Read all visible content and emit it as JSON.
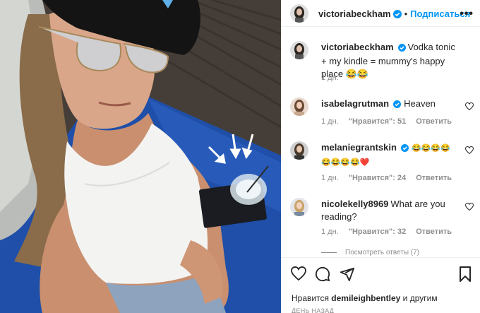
{
  "post": {
    "author": "victoriabeckham",
    "follow_label": "Подписаться",
    "dot": "•",
    "more_label": "•••"
  },
  "caption": {
    "username": "victoriabeckham",
    "text": "Vodka tonic + my kindle = mummy's happy place 😂😂",
    "time": "1 дн."
  },
  "comments": [
    {
      "username": "isabelagrutman",
      "verified": true,
      "text": "Heaven",
      "time": "1 дн.",
      "likes": "\"Нравится\": 51",
      "reply": "Ответить"
    },
    {
      "username": "melaniegrantskin",
      "verified": true,
      "text": "😂😂😂😂😂😂😂😂❤️",
      "time": "1 дн.",
      "likes": "\"Нравится\": 24",
      "reply": "Ответить"
    },
    {
      "username": "nicolekelly8969",
      "verified": false,
      "text": "What are you reading?",
      "time": "1 дн.",
      "likes": "\"Нравится\": 32",
      "reply": "Ответить",
      "view_replies": "Посмотреть ответы (7)"
    }
  ],
  "footer": {
    "liked_prefix": "Нравится",
    "liked_user": "demileighbentley",
    "liked_suffix": "и другим",
    "timestamp": "ДЕНЬ НАЗАД"
  },
  "icons": {
    "verified": "verified-badge-icon",
    "heart": "heart-icon",
    "comment": "comment-icon",
    "share": "share-icon",
    "save": "bookmark-icon",
    "more": "more-options-icon"
  },
  "colors": {
    "accent": "#0095f6",
    "text": "#262626",
    "muted": "#8e8e8e",
    "border": "#efefef"
  }
}
